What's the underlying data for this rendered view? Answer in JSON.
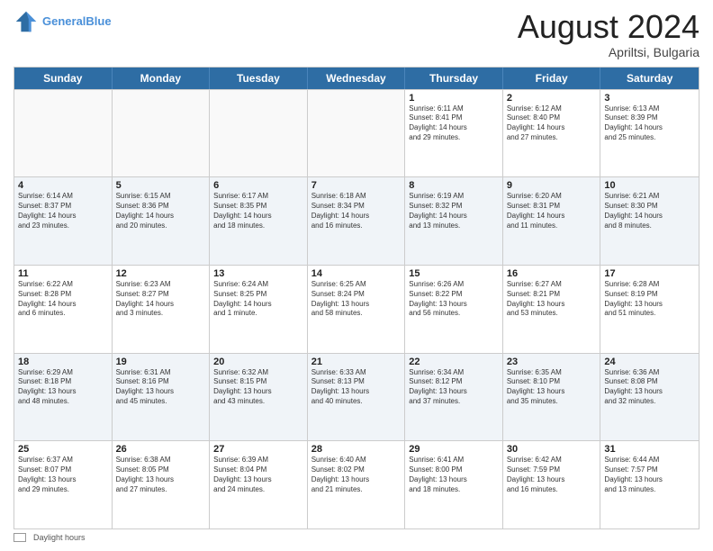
{
  "header": {
    "logo_line1": "General",
    "logo_line2": "Blue",
    "month": "August 2024",
    "location": "Apriltsi, Bulgaria"
  },
  "weekdays": [
    "Sunday",
    "Monday",
    "Tuesday",
    "Wednesday",
    "Thursday",
    "Friday",
    "Saturday"
  ],
  "rows": [
    [
      {
        "day": "",
        "lines": [],
        "empty": true
      },
      {
        "day": "",
        "lines": [],
        "empty": true
      },
      {
        "day": "",
        "lines": [],
        "empty": true
      },
      {
        "day": "",
        "lines": [],
        "empty": true
      },
      {
        "day": "1",
        "lines": [
          "Sunrise: 6:11 AM",
          "Sunset: 8:41 PM",
          "Daylight: 14 hours",
          "and 29 minutes."
        ],
        "empty": false
      },
      {
        "day": "2",
        "lines": [
          "Sunrise: 6:12 AM",
          "Sunset: 8:40 PM",
          "Daylight: 14 hours",
          "and 27 minutes."
        ],
        "empty": false
      },
      {
        "day": "3",
        "lines": [
          "Sunrise: 6:13 AM",
          "Sunset: 8:39 PM",
          "Daylight: 14 hours",
          "and 25 minutes."
        ],
        "empty": false
      }
    ],
    [
      {
        "day": "4",
        "lines": [
          "Sunrise: 6:14 AM",
          "Sunset: 8:37 PM",
          "Daylight: 14 hours",
          "and 23 minutes."
        ],
        "empty": false
      },
      {
        "day": "5",
        "lines": [
          "Sunrise: 6:15 AM",
          "Sunset: 8:36 PM",
          "Daylight: 14 hours",
          "and 20 minutes."
        ],
        "empty": false
      },
      {
        "day": "6",
        "lines": [
          "Sunrise: 6:17 AM",
          "Sunset: 8:35 PM",
          "Daylight: 14 hours",
          "and 18 minutes."
        ],
        "empty": false
      },
      {
        "day": "7",
        "lines": [
          "Sunrise: 6:18 AM",
          "Sunset: 8:34 PM",
          "Daylight: 14 hours",
          "and 16 minutes."
        ],
        "empty": false
      },
      {
        "day": "8",
        "lines": [
          "Sunrise: 6:19 AM",
          "Sunset: 8:32 PM",
          "Daylight: 14 hours",
          "and 13 minutes."
        ],
        "empty": false
      },
      {
        "day": "9",
        "lines": [
          "Sunrise: 6:20 AM",
          "Sunset: 8:31 PM",
          "Daylight: 14 hours",
          "and 11 minutes."
        ],
        "empty": false
      },
      {
        "day": "10",
        "lines": [
          "Sunrise: 6:21 AM",
          "Sunset: 8:30 PM",
          "Daylight: 14 hours",
          "and 8 minutes."
        ],
        "empty": false
      }
    ],
    [
      {
        "day": "11",
        "lines": [
          "Sunrise: 6:22 AM",
          "Sunset: 8:28 PM",
          "Daylight: 14 hours",
          "and 6 minutes."
        ],
        "empty": false
      },
      {
        "day": "12",
        "lines": [
          "Sunrise: 6:23 AM",
          "Sunset: 8:27 PM",
          "Daylight: 14 hours",
          "and 3 minutes."
        ],
        "empty": false
      },
      {
        "day": "13",
        "lines": [
          "Sunrise: 6:24 AM",
          "Sunset: 8:25 PM",
          "Daylight: 14 hours",
          "and 1 minute."
        ],
        "empty": false
      },
      {
        "day": "14",
        "lines": [
          "Sunrise: 6:25 AM",
          "Sunset: 8:24 PM",
          "Daylight: 13 hours",
          "and 58 minutes."
        ],
        "empty": false
      },
      {
        "day": "15",
        "lines": [
          "Sunrise: 6:26 AM",
          "Sunset: 8:22 PM",
          "Daylight: 13 hours",
          "and 56 minutes."
        ],
        "empty": false
      },
      {
        "day": "16",
        "lines": [
          "Sunrise: 6:27 AM",
          "Sunset: 8:21 PM",
          "Daylight: 13 hours",
          "and 53 minutes."
        ],
        "empty": false
      },
      {
        "day": "17",
        "lines": [
          "Sunrise: 6:28 AM",
          "Sunset: 8:19 PM",
          "Daylight: 13 hours",
          "and 51 minutes."
        ],
        "empty": false
      }
    ],
    [
      {
        "day": "18",
        "lines": [
          "Sunrise: 6:29 AM",
          "Sunset: 8:18 PM",
          "Daylight: 13 hours",
          "and 48 minutes."
        ],
        "empty": false
      },
      {
        "day": "19",
        "lines": [
          "Sunrise: 6:31 AM",
          "Sunset: 8:16 PM",
          "Daylight: 13 hours",
          "and 45 minutes."
        ],
        "empty": false
      },
      {
        "day": "20",
        "lines": [
          "Sunrise: 6:32 AM",
          "Sunset: 8:15 PM",
          "Daylight: 13 hours",
          "and 43 minutes."
        ],
        "empty": false
      },
      {
        "day": "21",
        "lines": [
          "Sunrise: 6:33 AM",
          "Sunset: 8:13 PM",
          "Daylight: 13 hours",
          "and 40 minutes."
        ],
        "empty": false
      },
      {
        "day": "22",
        "lines": [
          "Sunrise: 6:34 AM",
          "Sunset: 8:12 PM",
          "Daylight: 13 hours",
          "and 37 minutes."
        ],
        "empty": false
      },
      {
        "day": "23",
        "lines": [
          "Sunrise: 6:35 AM",
          "Sunset: 8:10 PM",
          "Daylight: 13 hours",
          "and 35 minutes."
        ],
        "empty": false
      },
      {
        "day": "24",
        "lines": [
          "Sunrise: 6:36 AM",
          "Sunset: 8:08 PM",
          "Daylight: 13 hours",
          "and 32 minutes."
        ],
        "empty": false
      }
    ],
    [
      {
        "day": "25",
        "lines": [
          "Sunrise: 6:37 AM",
          "Sunset: 8:07 PM",
          "Daylight: 13 hours",
          "and 29 minutes."
        ],
        "empty": false
      },
      {
        "day": "26",
        "lines": [
          "Sunrise: 6:38 AM",
          "Sunset: 8:05 PM",
          "Daylight: 13 hours",
          "and 27 minutes."
        ],
        "empty": false
      },
      {
        "day": "27",
        "lines": [
          "Sunrise: 6:39 AM",
          "Sunset: 8:04 PM",
          "Daylight: 13 hours",
          "and 24 minutes."
        ],
        "empty": false
      },
      {
        "day": "28",
        "lines": [
          "Sunrise: 6:40 AM",
          "Sunset: 8:02 PM",
          "Daylight: 13 hours",
          "and 21 minutes."
        ],
        "empty": false
      },
      {
        "day": "29",
        "lines": [
          "Sunrise: 6:41 AM",
          "Sunset: 8:00 PM",
          "Daylight: 13 hours",
          "and 18 minutes."
        ],
        "empty": false
      },
      {
        "day": "30",
        "lines": [
          "Sunrise: 6:42 AM",
          "Sunset: 7:59 PM",
          "Daylight: 13 hours",
          "and 16 minutes."
        ],
        "empty": false
      },
      {
        "day": "31",
        "lines": [
          "Sunrise: 6:44 AM",
          "Sunset: 7:57 PM",
          "Daylight: 13 hours",
          "and 13 minutes."
        ],
        "empty": false
      }
    ]
  ],
  "footer": {
    "legend_label": "Daylight hours"
  }
}
